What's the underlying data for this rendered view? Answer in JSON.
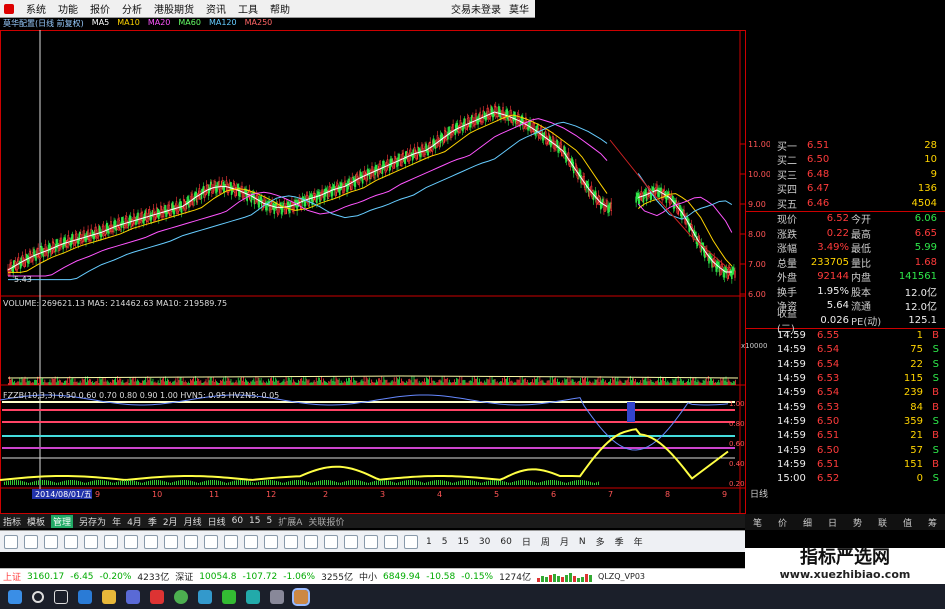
{
  "menubar": {
    "items": [
      "系统",
      "功能",
      "报价",
      "分析",
      "港股期货",
      "资讯",
      "工具",
      "帮助"
    ],
    "right": [
      "交易未登录",
      "莫华"
    ]
  },
  "titlebar": {
    "segments": [
      "莫华配置(日线 前复权)",
      "MA5",
      "MA10",
      "MA20",
      "MA60",
      "MA120",
      "MA250"
    ]
  },
  "price_chart": {
    "axis_labels": [
      "11.00",
      "10.00",
      "9.00",
      "8.00",
      "7.00",
      "6.00"
    ],
    "low_marker": "5.43"
  },
  "volume": {
    "label": "VOLUME: 269621.13  MA5: 214462.63  MA10: 219589.75",
    "axis_unit": "x10000"
  },
  "indicator": {
    "label": "FZZB(10,3,3)  0.50  0.60  0.70  0.80  0.90  1.00  HVN5: 0.95  HV2N5: 0.05",
    "axis_labels": [
      "1.00",
      "0.80",
      "0.60",
      "0.40",
      "0.20"
    ]
  },
  "date_axis": {
    "current": "2014/08/01/五",
    "months": [
      "9",
      "10",
      "11",
      "12",
      "2",
      "3",
      "4",
      "5",
      "6",
      "7",
      "8",
      "9"
    ],
    "period": "日线"
  },
  "quote": {
    "bids": [
      {
        "label": "买一",
        "price": "6.51",
        "vol": "28"
      },
      {
        "label": "买二",
        "price": "6.50",
        "vol": "10"
      },
      {
        "label": "买三",
        "price": "6.48",
        "vol": "9"
      },
      {
        "label": "买四",
        "price": "6.47",
        "vol": "136"
      },
      {
        "label": "买五",
        "price": "6.46",
        "vol": "4504"
      }
    ],
    "stats": [
      {
        "l1": "现价",
        "v1": "6.52",
        "l2": "今开",
        "v2": "6.06",
        "c1": "red",
        "c2": "green"
      },
      {
        "l1": "涨跌",
        "v1": "0.22",
        "l2": "最高",
        "v2": "6.65",
        "c1": "red",
        "c2": "red"
      },
      {
        "l1": "涨幅",
        "v1": "3.49%",
        "l2": "最低",
        "v2": "5.99",
        "c1": "red",
        "c2": "green"
      },
      {
        "l1": "总量",
        "v1": "233705",
        "l2": "量比",
        "v2": "1.68",
        "c1": "yellow",
        "c2": "red"
      },
      {
        "l1": "外盘",
        "v1": "92144",
        "l2": "内盘",
        "v2": "141561",
        "c1": "red",
        "c2": "green"
      },
      {
        "l1": "换手",
        "v1": "1.95%",
        "l2": "股本",
        "v2": "12.0亿",
        "c1": "white",
        "c2": "white"
      },
      {
        "l1": "净资",
        "v1": "5.64",
        "l2": "流通",
        "v2": "12.0亿",
        "c1": "white",
        "c2": "white"
      },
      {
        "l1": "收益(二)",
        "v1": "0.026",
        "l2": "PE(动)",
        "v2": "125.1",
        "c1": "white",
        "c2": "white"
      }
    ],
    "ticks": [
      {
        "t": "14:59",
        "p": "6.55",
        "v": "1",
        "d": "B"
      },
      {
        "t": "14:59",
        "p": "6.54",
        "v": "75",
        "d": "S"
      },
      {
        "t": "14:59",
        "p": "6.54",
        "v": "22",
        "d": "S"
      },
      {
        "t": "14:59",
        "p": "6.53",
        "v": "115",
        "d": "S"
      },
      {
        "t": "14:59",
        "p": "6.54",
        "v": "239",
        "d": "B"
      },
      {
        "t": "14:59",
        "p": "6.53",
        "v": "84",
        "d": "B"
      },
      {
        "t": "14:59",
        "p": "6.50",
        "v": "359",
        "d": "S"
      },
      {
        "t": "14:59",
        "p": "6.51",
        "v": "21",
        "d": "B"
      },
      {
        "t": "14:59",
        "p": "6.50",
        "v": "57",
        "d": "S"
      },
      {
        "t": "14:59",
        "p": "6.51",
        "v": "151",
        "d": "B"
      },
      {
        "t": "15:00",
        "p": "6.52",
        "v": "0",
        "d": "S"
      }
    ]
  },
  "toolbar1": [
    "指标",
    "模板",
    "管理",
    "另存为",
    "年",
    "4月",
    "季",
    "2月",
    "月线",
    "日线",
    "60",
    "15",
    "5"
  ],
  "toolbar1_selected": "管理",
  "toolbar2": [
    "扩展A",
    "关联报价"
  ],
  "iconbar_periods": [
    "1",
    "5",
    "15",
    "30",
    "60",
    "日",
    "周",
    "月",
    "N",
    "多",
    "季",
    "年"
  ],
  "panel_tabs": [
    "笔",
    "价",
    "细",
    "日",
    "势",
    "联",
    "值",
    "筹"
  ],
  "statusbar": {
    "sh_name": "上证",
    "sh_val": "3160.17",
    "sh_chg": "-6.45",
    "sh_pct": "-0.20%",
    "sh_amt": "4233亿",
    "sz_name": "深证",
    "sz_val": "10054.8",
    "sz_chg": "-107.72",
    "sz_pct": "-1.06%",
    "sz_amt": "3255亿",
    "zx_name": "中小",
    "zx_val": "6849.94",
    "zx_chg": "-10.58",
    "zx_pct": "-0.15%",
    "zx_amt": "1274亿",
    "code": "QLZQ_VP03"
  },
  "watermark": {
    "title": "指标严选网",
    "url": "www.xuezhibiao.com"
  },
  "colors": {
    "up": "#ff3b3b",
    "down": "#2ee84a",
    "ma1": "#ffffff",
    "ma2": "#ffd400",
    "ma3": "#ff55ff",
    "indicator": "#ffff44"
  }
}
